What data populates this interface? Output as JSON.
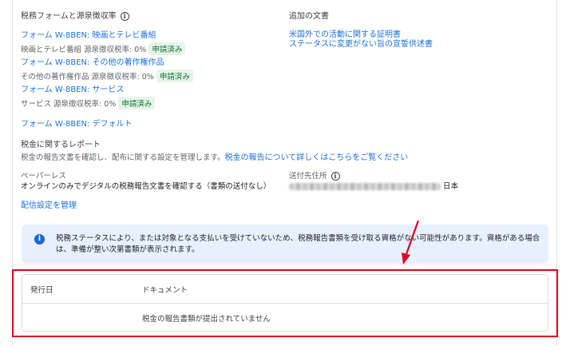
{
  "tax_forms": {
    "heading": "税務フォームと源泉徴収率",
    "items": [
      {
        "link": "フォーム W-8BEN: 映画とテレビ番組",
        "rate_text": "映画とテレビ番組 源泉徴収税率: 0%",
        "badge": "申請済み"
      },
      {
        "link": "フォーム W-8BEN: その他の著作権作品",
        "rate_text": "その他の著作権作品 源泉徴収税率: 0%",
        "badge": "申請済み"
      },
      {
        "link": "フォーム W-8BEN: サービス",
        "rate_text": "サービス 源泉徴収税率: 0%",
        "badge": "申請済み"
      }
    ],
    "default_link": "フォーム W-8BEN: デフォルト"
  },
  "additional_docs": {
    "heading": "追加の文書",
    "links": [
      "米国外での活動に関する証明書",
      "ステータスに変更がない旨の宣誓供述書"
    ]
  },
  "tax_reports": {
    "heading": "税金に関するレポート",
    "description": "税金の報告文書を確認し、配布に関する設定を管理します。",
    "learn_more": "税金の報告について詳しくはこちらをご覧ください"
  },
  "paperless": {
    "label": "ペーパーレス",
    "value": "オンラインのみでデジタルの税務報告文書を確認する（書類の送付なし）"
  },
  "send_to": {
    "label": "送付先住所",
    "country": "日本"
  },
  "manage_delivery": "配信設定を管理",
  "banner": {
    "text": "税務ステータスにより、または対象となる支払いを受けていないため、税務報告書類を受け取る資格がない可能性があります。資格がある場合は、準備が整い次第書類が表示されます。"
  },
  "documents_table": {
    "columns": [
      "発行日",
      "ドキュメント"
    ],
    "empty_message": "税金の報告書類が提出されていません"
  },
  "colors": {
    "link": "#1a73e8",
    "badge_bg": "#e6f4ea",
    "badge_text": "#137333",
    "banner_bg": "#e8f0fe",
    "annotation_red": "#e2001a"
  }
}
